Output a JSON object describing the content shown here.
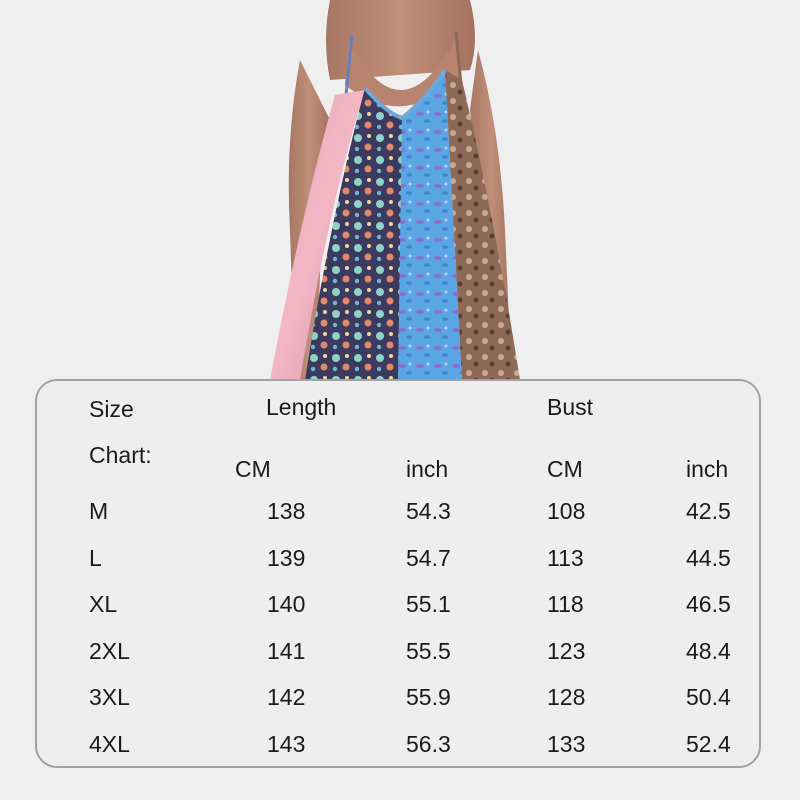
{
  "size_chart": {
    "title_line1": "Size",
    "title_line2": "Chart:",
    "length_header": "Length",
    "bust_header": "Bust",
    "units": [
      "CM",
      "inch",
      "CM",
      "inch"
    ],
    "rows": [
      {
        "size": "M",
        "length_cm": "138",
        "length_inch": "54.3",
        "bust_cm": "108",
        "bust_inch": "42.5"
      },
      {
        "size": "L",
        "length_cm": "139",
        "length_inch": "54.7",
        "bust_cm": "113",
        "bust_inch": "44.5"
      },
      {
        "size": "XL",
        "length_cm": "140",
        "length_inch": "55.1",
        "bust_cm": "118",
        "bust_inch": "46.5"
      },
      {
        "size": "2XL",
        "length_cm": "141",
        "length_inch": "55.5",
        "bust_cm": "123",
        "bust_inch": "48.4"
      },
      {
        "size": "3XL",
        "length_cm": "142",
        "length_inch": "55.9",
        "bust_cm": "128",
        "bust_inch": "50.4"
      },
      {
        "size": "4XL",
        "length_cm": "143",
        "length_inch": "56.3",
        "bust_cm": "133",
        "bust_inch": "52.4"
      }
    ]
  }
}
